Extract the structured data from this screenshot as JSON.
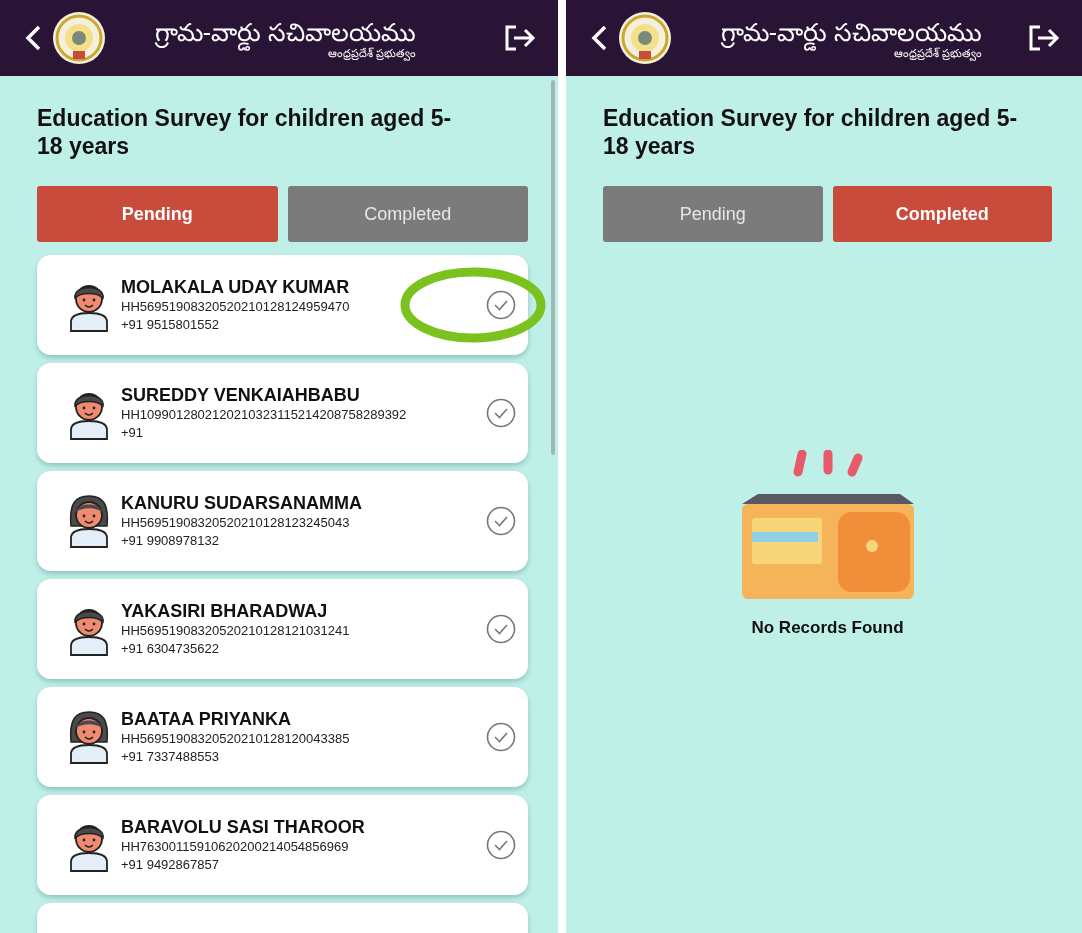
{
  "screens": [
    {
      "header": {
        "title": "గ్రామ-వార్డు సచివాలయము",
        "subtitle": "ఆంధ్రప్రదేశ్ ప్రభుత్వం"
      },
      "heading": "Education Survey for children aged 5-18 years",
      "tabs": [
        {
          "label": "Pending",
          "selected": true
        },
        {
          "label": "Completed",
          "selected": false
        }
      ],
      "records": [
        {
          "kind": "boy",
          "name": "MOLAKALA UDAY KUMAR",
          "household_id": "HH56951908320520210128124959470",
          "phone": "+91 9515801552",
          "highlighted": true
        },
        {
          "kind": "boy",
          "name": "SUREDDY VENKAIAHBABU",
          "household_id": "HH1099012802120210323115214208758289392",
          "phone": "+91",
          "highlighted": false
        },
        {
          "kind": "girl",
          "name": "KANURU SUDARSANAMMA",
          "household_id": "HH56951908320520210128123245043",
          "phone": "+91 9908978132",
          "highlighted": false
        },
        {
          "kind": "boy",
          "name": "YAKASIRI BHARADWAJ",
          "household_id": "HH56951908320520210128121031241",
          "phone": "+91 6304735622",
          "highlighted": false
        },
        {
          "kind": "girl",
          "name": "BAATAA PRIYANKA",
          "household_id": "HH56951908320520210128120043385",
          "phone": "+91 7337488553",
          "highlighted": false
        },
        {
          "kind": "boy",
          "name": "BARAVOLU SASI THAROOR",
          "household_id": "HH76300115910620200214054856969",
          "phone": "+91 9492867857",
          "highlighted": false
        },
        {
          "kind": "stub"
        }
      ]
    },
    {
      "header": {
        "title": "గ్రామ-వార్డు సచివాలయము",
        "subtitle": "ఆంధ్రప్రదేశ్ ప్రభుత్వం"
      },
      "heading": "Education Survey for children aged 5-18 years",
      "tabs": [
        {
          "label": "Pending",
          "selected": false
        },
        {
          "label": "Completed",
          "selected": true
        }
      ],
      "empty_message": "No Records Found"
    }
  ]
}
